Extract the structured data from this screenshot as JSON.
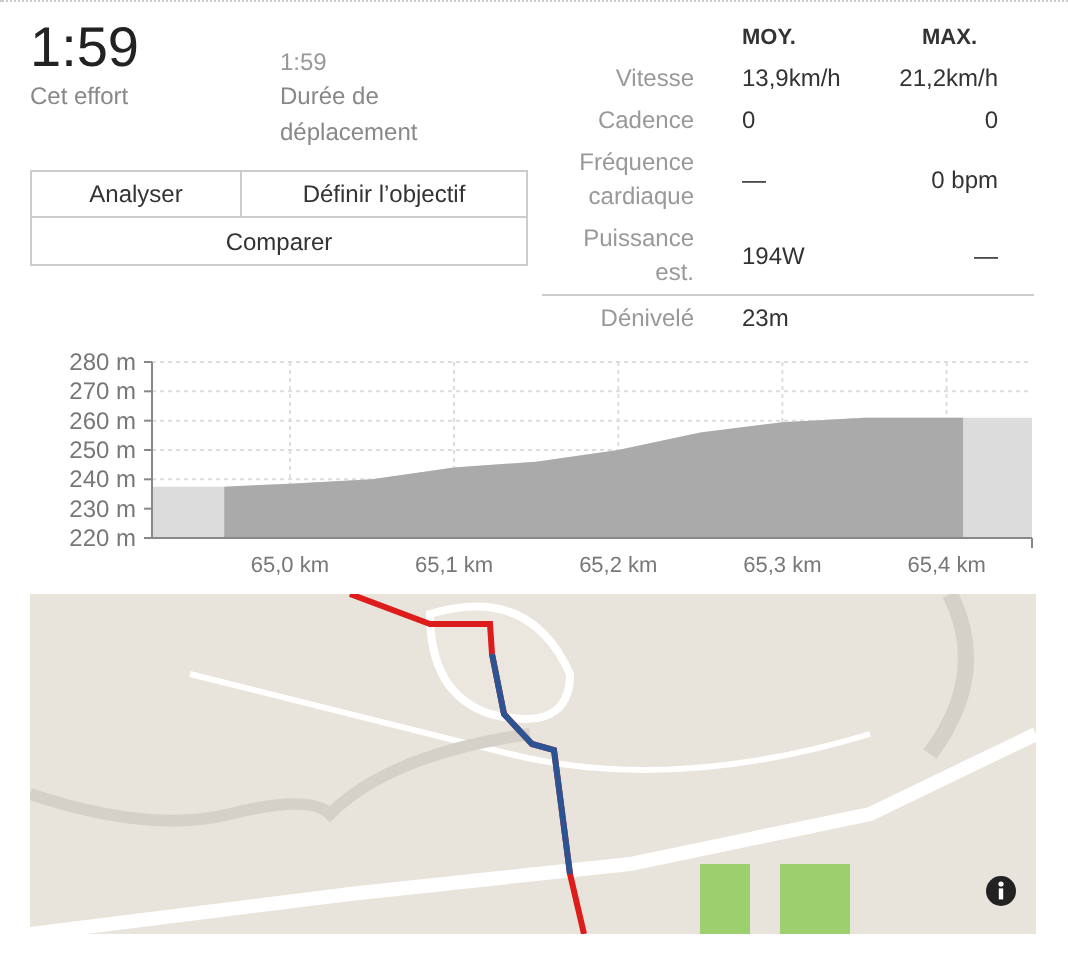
{
  "effort": {
    "value": "1:59",
    "label": "Cet effort"
  },
  "moving_time": {
    "value": "1:59",
    "label": "Durée de déplacement"
  },
  "buttons": [
    {
      "label": "Analyser"
    },
    {
      "label": "Définir l’objectif"
    },
    {
      "label": "Comparer"
    }
  ],
  "stats": {
    "columns": [
      "MOY.",
      "MAX."
    ],
    "rows": [
      {
        "label": "Vitesse",
        "avg": "13,9km/h",
        "max": "21,2km/h"
      },
      {
        "label": "Cadence",
        "avg": "0",
        "max": "0"
      },
      {
        "label": "Fréquence cardiaque",
        "avg": "—",
        "max": "0 bpm"
      },
      {
        "label": "Puissance est.",
        "avg": "194W",
        "max": "—"
      }
    ],
    "summary": {
      "label": "Dénivelé",
      "value": "23m"
    }
  },
  "elevation": {
    "chart_data": {
      "type": "area",
      "x": [
        64.916,
        64.96,
        65.0,
        65.05,
        65.1,
        65.15,
        65.2,
        65.25,
        65.3,
        65.35,
        65.4,
        65.41,
        65.452
      ],
      "series": [
        {
          "color": "#dcdcdc",
          "values": [
            237.5,
            237.5,
            238.5,
            240,
            244,
            246,
            250,
            256,
            259.5,
            261,
            261,
            261,
            261
          ]
        },
        {
          "color": "#aaaaaa",
          "values": [
            null,
            237.5,
            238.5,
            240,
            244,
            246,
            250,
            256,
            259.5,
            261,
            261,
            261,
            null
          ]
        }
      ],
      "xlim": [
        64.916,
        65.452
      ],
      "ylim": [
        220,
        280
      ],
      "xticks": [
        {
          "value": 65.0,
          "label": "65,0 km"
        },
        {
          "value": 65.1,
          "label": "65,1 km"
        },
        {
          "value": 65.2,
          "label": "65,2 km"
        },
        {
          "value": 65.3,
          "label": "65,3 km"
        },
        {
          "value": 65.4,
          "label": "65,4 km"
        }
      ],
      "yticks": [
        {
          "value": 220,
          "label": "220 m"
        },
        {
          "value": 230,
          "label": "230 m"
        },
        {
          "value": 240,
          "label": "240 m"
        },
        {
          "value": 250,
          "label": "250 m"
        },
        {
          "value": 260,
          "label": "260 m"
        },
        {
          "value": 270,
          "label": "270 m"
        },
        {
          "value": 280,
          "label": "280 m"
        }
      ],
      "grid": true
    }
  }
}
